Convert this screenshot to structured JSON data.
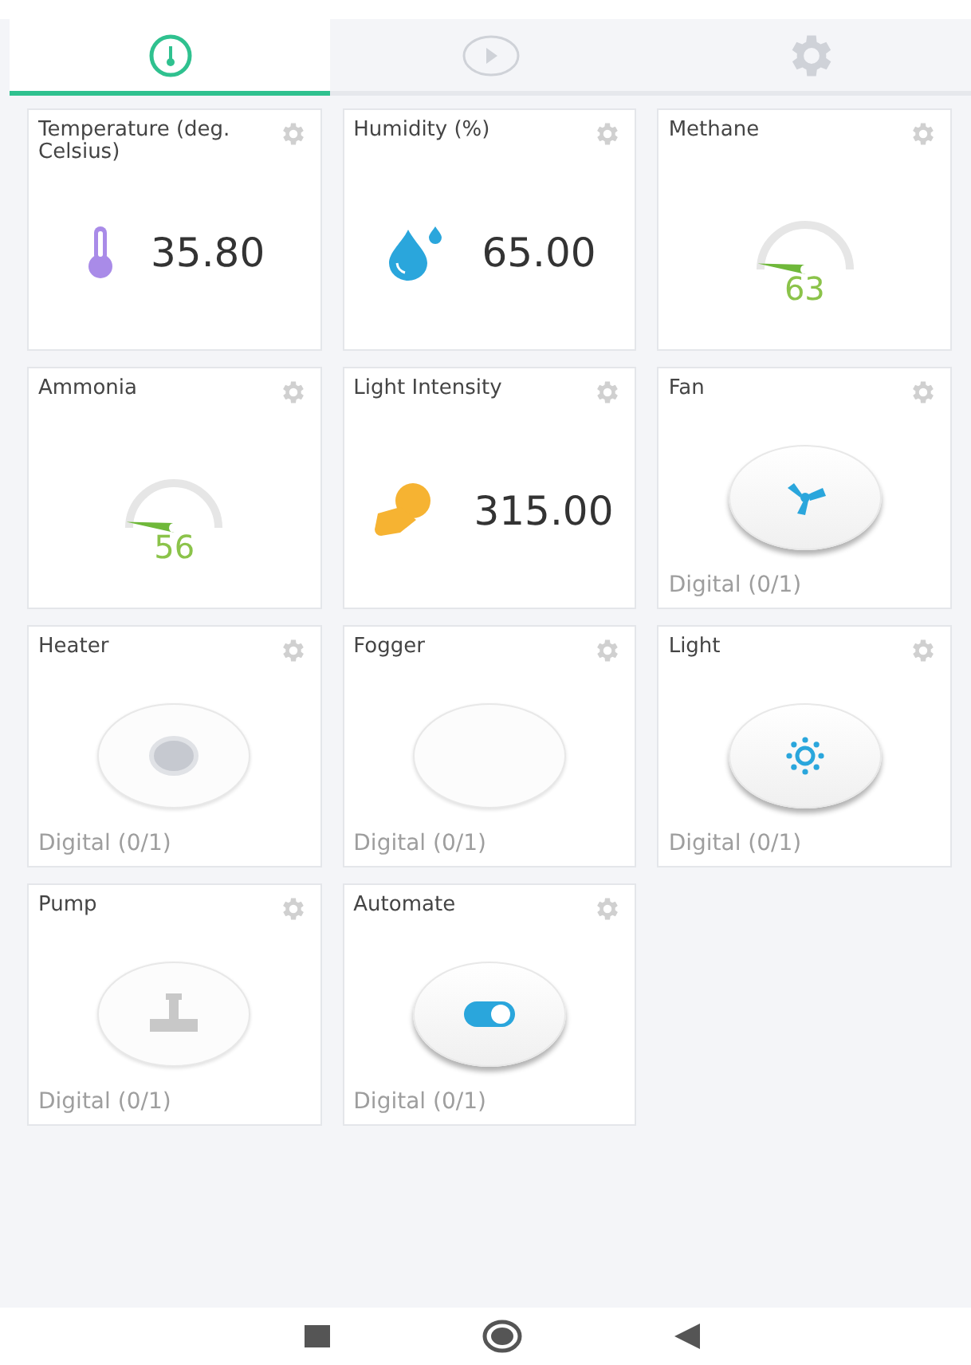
{
  "tabs": [
    {
      "selected": true
    },
    {
      "selected": false
    },
    {
      "selected": false
    }
  ],
  "widgets": [
    {
      "kind": "value",
      "title": "Temperature (deg. Celsius)",
      "value": "35.80"
    },
    {
      "kind": "value",
      "title": "Humidity (%)",
      "value": "65.00"
    },
    {
      "kind": "gauge",
      "title": "Methane",
      "reading": "63"
    },
    {
      "kind": "gauge",
      "title": "Ammonia",
      "reading": "56"
    },
    {
      "kind": "value",
      "title": "Light Intensity",
      "value": "315.00"
    },
    {
      "kind": "switch",
      "title": "Fan",
      "on": true,
      "footer": "Digital (0/1)"
    },
    {
      "kind": "switch",
      "title": "Heater",
      "on": false,
      "footer": "Digital (0/1)"
    },
    {
      "kind": "switch",
      "title": "Fogger",
      "on": false,
      "footer": "Digital (0/1)"
    },
    {
      "kind": "switch",
      "title": "Light",
      "on": true,
      "footer": "Digital (0/1)"
    },
    {
      "kind": "switch",
      "title": "Pump",
      "on": false,
      "footer": "Digital (0/1)"
    },
    {
      "kind": "switch",
      "title": "Automate",
      "on": true,
      "footer": "Digital (0/1)"
    }
  ]
}
